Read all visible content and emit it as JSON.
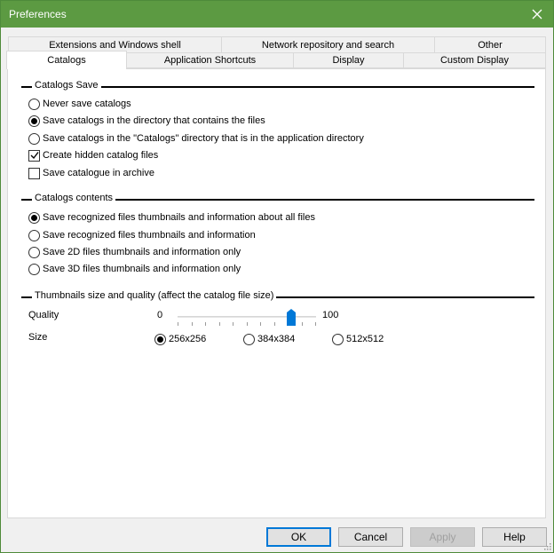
{
  "window": {
    "title": "Preferences"
  },
  "tabs_back": [
    {
      "label": "Extensions and Windows shell"
    },
    {
      "label": "Network repository and search"
    },
    {
      "label": "Other"
    }
  ],
  "tabs_front": [
    {
      "label": "Catalogs",
      "active": true
    },
    {
      "label": "Application Shortcuts"
    },
    {
      "label": "Display"
    },
    {
      "label": "Custom Display"
    }
  ],
  "catalogs_save": {
    "title": "Catalogs Save",
    "options": [
      {
        "label": "Never save catalogs",
        "selected": false
      },
      {
        "label": "Save catalogs in the directory that contains the files",
        "selected": true
      },
      {
        "label": "Save catalogs in the \"Catalogs\" directory that is in the application directory",
        "selected": false
      }
    ],
    "checkboxes": [
      {
        "label": "Create hidden catalog files",
        "checked": true
      },
      {
        "label": "Save catalogue in archive",
        "checked": false
      }
    ]
  },
  "catalogs_contents": {
    "title": "Catalogs contents",
    "options": [
      {
        "label": "Save recognized files thumbnails and information about all files",
        "selected": true
      },
      {
        "label": "Save recognized files thumbnails and information",
        "selected": false
      },
      {
        "label": "Save 2D files thumbnails and information only",
        "selected": false
      },
      {
        "label": "Save 3D files thumbnails and information only",
        "selected": false
      }
    ]
  },
  "thumbnails": {
    "title": "Thumbnails size and quality (affect the catalog file size)",
    "quality_label": "Quality",
    "quality_min": "0",
    "quality_max": "100",
    "quality_value": 83,
    "size_label": "Size",
    "sizes": [
      {
        "label": "256x256",
        "selected": true
      },
      {
        "label": "384x384",
        "selected": false
      },
      {
        "label": "512x512",
        "selected": false
      }
    ]
  },
  "buttons": {
    "ok": "OK",
    "cancel": "Cancel",
    "apply": "Apply",
    "help": "Help"
  },
  "colors": {
    "titlebar": "#5c9a42",
    "accent": "#0078d7"
  }
}
